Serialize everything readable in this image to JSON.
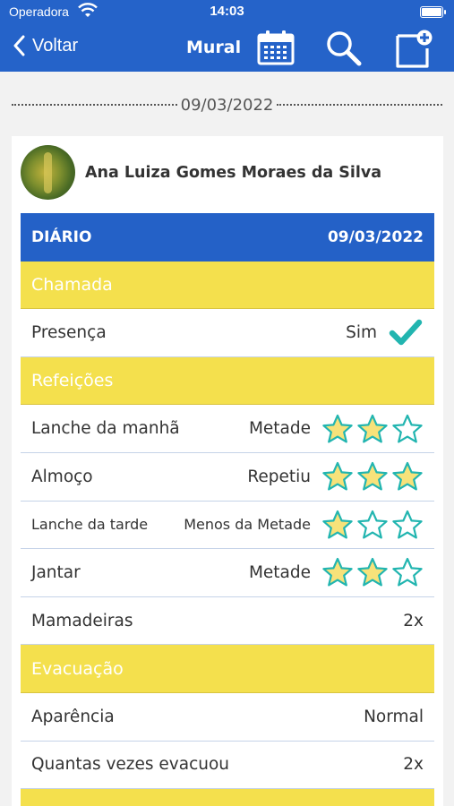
{
  "status_bar": {
    "carrier": "Operadora",
    "time": "14:03"
  },
  "nav": {
    "back_label": "Voltar",
    "title": "Mural",
    "calendar_icon": "calendar-icon",
    "search_icon": "search-icon",
    "add_icon": "add-note-icon"
  },
  "date_separator": "09/03/2022",
  "student": {
    "name": "Ana Luiza Gomes Moraes da Silva"
  },
  "diary": {
    "title": "DIÁRIO",
    "date": "09/03/2022",
    "sections": {
      "chamada": "Chamada",
      "refeicoes": "Refeições",
      "evacuacao": "Evacuação"
    },
    "presenca": {
      "label": "Presença",
      "value": "Sim"
    },
    "meals": [
      {
        "label": "Lanche da manhã",
        "amount": "Metade",
        "rating": 2
      },
      {
        "label": "Almoço",
        "amount": "Repetiu",
        "rating": 3
      },
      {
        "label": "Lanche da tarde",
        "amount": "Menos da Metade",
        "rating": 1
      },
      {
        "label": "Jantar",
        "amount": "Metade",
        "rating": 2
      }
    ],
    "mamadeiras": {
      "label": "Mamadeiras",
      "value": "2x"
    },
    "aparencia": {
      "label": "Aparência",
      "value": "Normal"
    },
    "quantas": {
      "label": "Quantas vezes evacuou",
      "value": "2x"
    }
  },
  "colors": {
    "primary": "#2563c9",
    "section": "#f4e04d",
    "star_fill": "#f7e27a",
    "star_stroke": "#22b5b0",
    "check": "#22b5b0"
  }
}
